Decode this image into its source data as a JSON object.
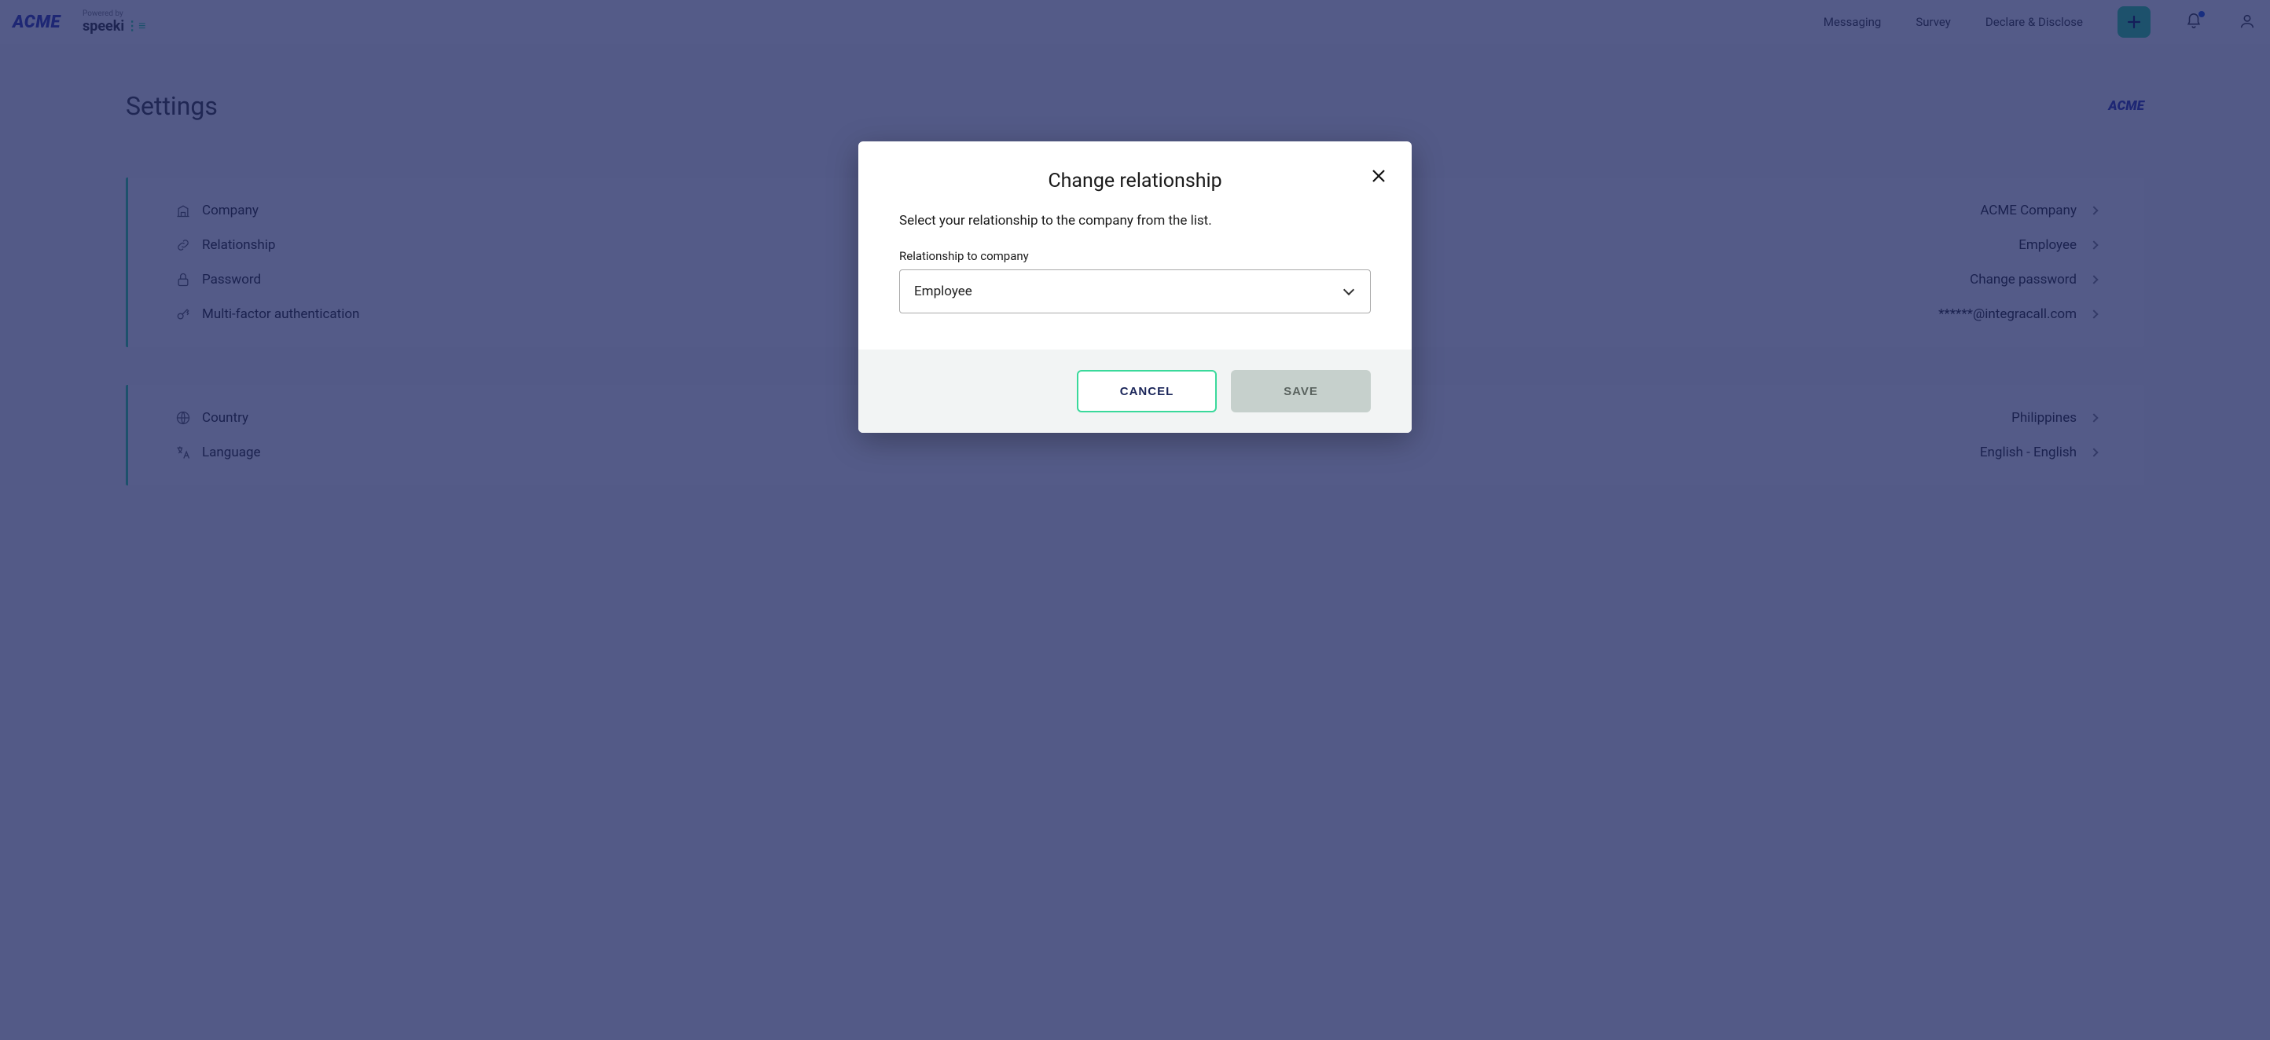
{
  "header": {
    "brand": "ACME",
    "powered_by": "Powered by",
    "speeki": "speeki",
    "nav": {
      "messaging": "Messaging",
      "survey": "Survey",
      "declare": "Declare & Disclose"
    }
  },
  "page": {
    "title": "Settings",
    "brand_small": "ACME"
  },
  "settings_account": {
    "company": {
      "label": "Company",
      "value": "ACME Company"
    },
    "relationship": {
      "label": "Relationship",
      "value": "Employee"
    },
    "password": {
      "label": "Password",
      "value": "Change password"
    },
    "mfa": {
      "label": "Multi-factor authentication",
      "value": "******@integracall.com"
    }
  },
  "settings_locale": {
    "country": {
      "label": "Country",
      "value": "Philippines"
    },
    "language": {
      "label": "Language",
      "value": "English - English"
    }
  },
  "modal": {
    "title": "Change relationship",
    "desc": "Select your relationship to the company from the list.",
    "field_label": "Relationship to company",
    "selected": "Employee",
    "cancel": "CANCEL",
    "save": "SAVE"
  }
}
